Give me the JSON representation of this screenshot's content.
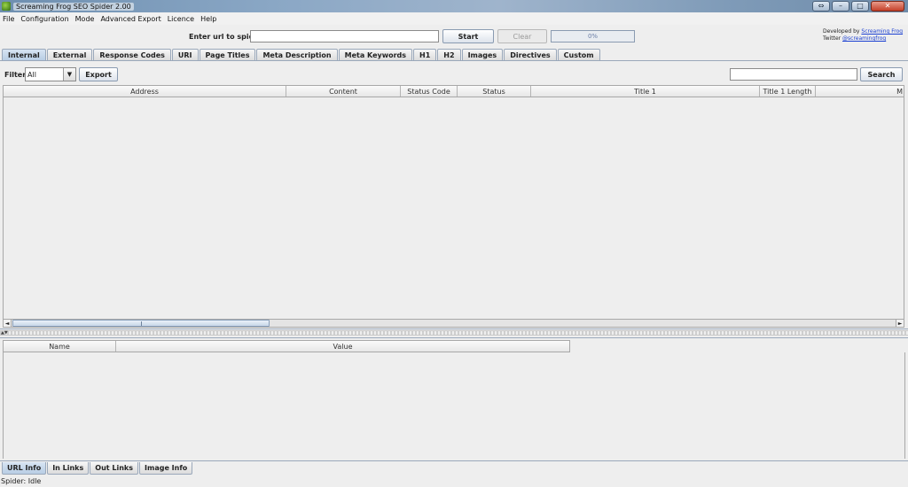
{
  "window": {
    "title": "Screaming Frog SEO Spider 2.00",
    "controls": {
      "restore_alt": "⇔",
      "minimize": "–",
      "maximize": "□",
      "close": "✕"
    }
  },
  "menu": [
    "File",
    "Configuration",
    "Mode",
    "Advanced Export",
    "Licence",
    "Help"
  ],
  "url_bar": {
    "label": "Enter url to spider:",
    "value": "",
    "start_label": "Start",
    "clear_label": "Clear",
    "progress_text": "0%",
    "progress_value": 0
  },
  "credits": {
    "developed_by": "Developed by",
    "developer_link": "Screaming Frog",
    "twitter_label": "Twitter",
    "twitter_link": "@screamingfrog"
  },
  "tabs": [
    "Internal",
    "External",
    "Response Codes",
    "URI",
    "Page Titles",
    "Meta Description",
    "Meta Keywords",
    "H1",
    "H2",
    "Images",
    "Directives",
    "Custom"
  ],
  "active_tab": 0,
  "toolbar": {
    "filter_label": "Filter:",
    "filter_value": "All",
    "export_label": "Export",
    "search_value": "",
    "search_label": "Search"
  },
  "grid": {
    "columns": [
      "Address",
      "Content",
      "Status Code",
      "Status",
      "Title 1",
      "Title 1 Length",
      "M"
    ],
    "rows": []
  },
  "detail_grid": {
    "columns": [
      "Name",
      "Value"
    ],
    "rows": []
  },
  "bottom_tabs": [
    "URL Info",
    "In Links",
    "Out Links",
    "Image Info"
  ],
  "active_bottom_tab": 0,
  "status": "Spider: Idle",
  "icons": {
    "app": "frog-icon",
    "dropdown": "▼",
    "scroll_left": "◄",
    "scroll_right": "►",
    "split_arrows": "▲▼"
  }
}
